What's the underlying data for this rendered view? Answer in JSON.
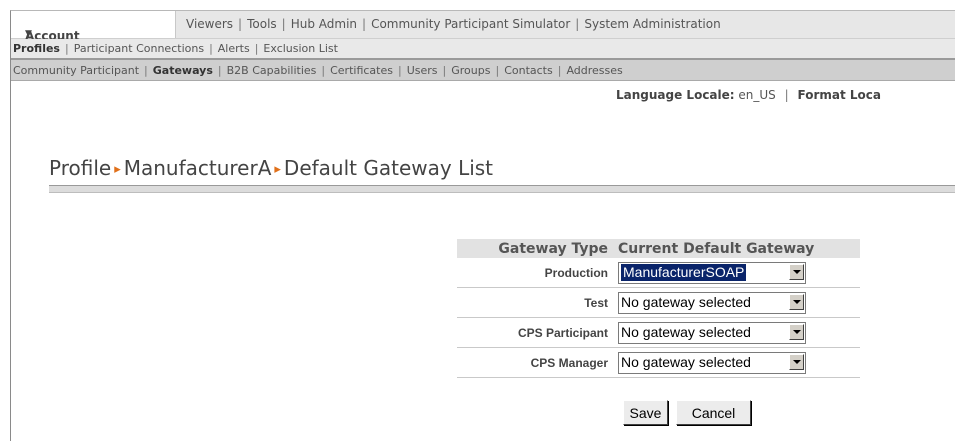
{
  "nav": {
    "active_tab": "Account Admin",
    "active_tab_icon": "caret-down-icon",
    "tabs": [
      "Viewers",
      "Tools",
      "Hub Admin",
      "Community Participant Simulator",
      "System Administration"
    ],
    "subnav": [
      "Profiles",
      "Participant Connections",
      "Alerts",
      "Exclusion List"
    ],
    "subsubnav": [
      "Community Participant",
      "Gateways",
      "B2B Capabilities",
      "Certificates",
      "Users",
      "Groups",
      "Contacts",
      "Addresses"
    ]
  },
  "locale": {
    "language_label": "Language Locale:",
    "language_value": "en_US",
    "format_label": "Format Loca"
  },
  "page": {
    "breadcrumb": [
      "Profile",
      "ManufacturerA",
      "Default Gateway List"
    ],
    "breadcrumb_separator_color": "#e0701a"
  },
  "table": {
    "headers": [
      "Gateway Type",
      "Current Default Gateway"
    ],
    "rows": [
      {
        "type": "Production",
        "gateway": "ManufacturerSOAP"
      },
      {
        "type": "Test",
        "gateway": "No gateway selected"
      },
      {
        "type": "CPS Participant",
        "gateway": "No gateway selected"
      },
      {
        "type": "CPS Manager",
        "gateway": "No gateway selected"
      }
    ]
  },
  "buttons": {
    "save": "Save",
    "cancel": "Cancel"
  }
}
